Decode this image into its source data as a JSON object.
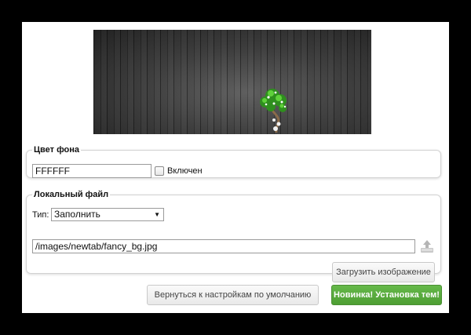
{
  "background_section": {
    "legend": "Цвет фона",
    "color_value": "FFFFFF",
    "enabled_label": "Включен"
  },
  "local_file_section": {
    "legend": "Локальный файл",
    "type_label": "Тип:",
    "type_value": "Заполнить",
    "file_path": "/images/newtab/fancy_bg.jpg",
    "upload_button": "Загрузить изображение"
  },
  "footer": {
    "reset_button": "Вернуться к настройкам по умолчанию",
    "new_button": "Новинка! Установка тем!"
  },
  "colors": {
    "accent_green": "#58a83c",
    "panel_background": "#ffffff",
    "frame_background": "#000000"
  },
  "icons": {
    "upload": "upload-icon",
    "dropdown": "chevron-down-icon"
  }
}
